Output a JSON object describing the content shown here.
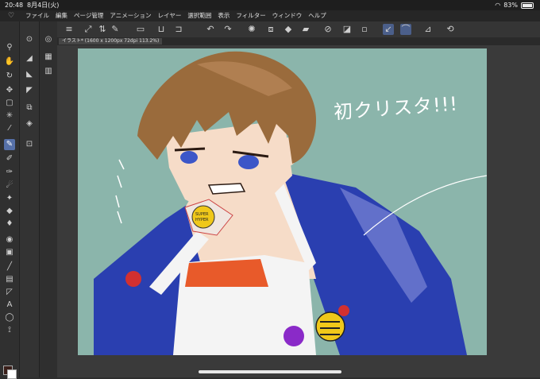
{
  "status": {
    "time": "20:48",
    "date": "8月4日(火)",
    "battery": "83%",
    "battery_level": 0.83
  },
  "menu": {
    "items": [
      "ファイル",
      "編集",
      "ページ管理",
      "アニメーション",
      "レイヤー",
      "選択範囲",
      "表示",
      "フィルター",
      "ウィンドウ",
      "ヘルプ"
    ]
  },
  "tab": {
    "label": "イラスト* (1600 x 1200px 72dpi 113.2%)"
  },
  "artwork": {
    "handwritten_text": "初クリスタ!!!",
    "badge_text_1": "SUPER",
    "badge_text_2": "HYPER",
    "colors": {
      "background": "#8bb5ab",
      "jacket": "#2a3fb0",
      "hair": "#9a6b3c",
      "skin": "#f6dcc8",
      "shirt": "#e85a2a"
    }
  },
  "left_tools": [
    "zoom-icon",
    "hand-icon",
    "rotate-icon",
    "move-icon",
    "selection-icon",
    "lasso-icon",
    "eyedropper-icon",
    "pen-icon",
    "pencil-icon",
    "brush-icon",
    "airbrush-icon",
    "decoration-icon",
    "eraser-icon",
    "blend-icon",
    "fill-icon",
    "gradient-icon",
    "figure-icon",
    "frame-icon",
    "ruler-icon",
    "text-icon",
    "balloon-icon",
    "correct-line-icon"
  ],
  "colors": {
    "main": "#3a1f1a",
    "sub": "#ffffff"
  }
}
